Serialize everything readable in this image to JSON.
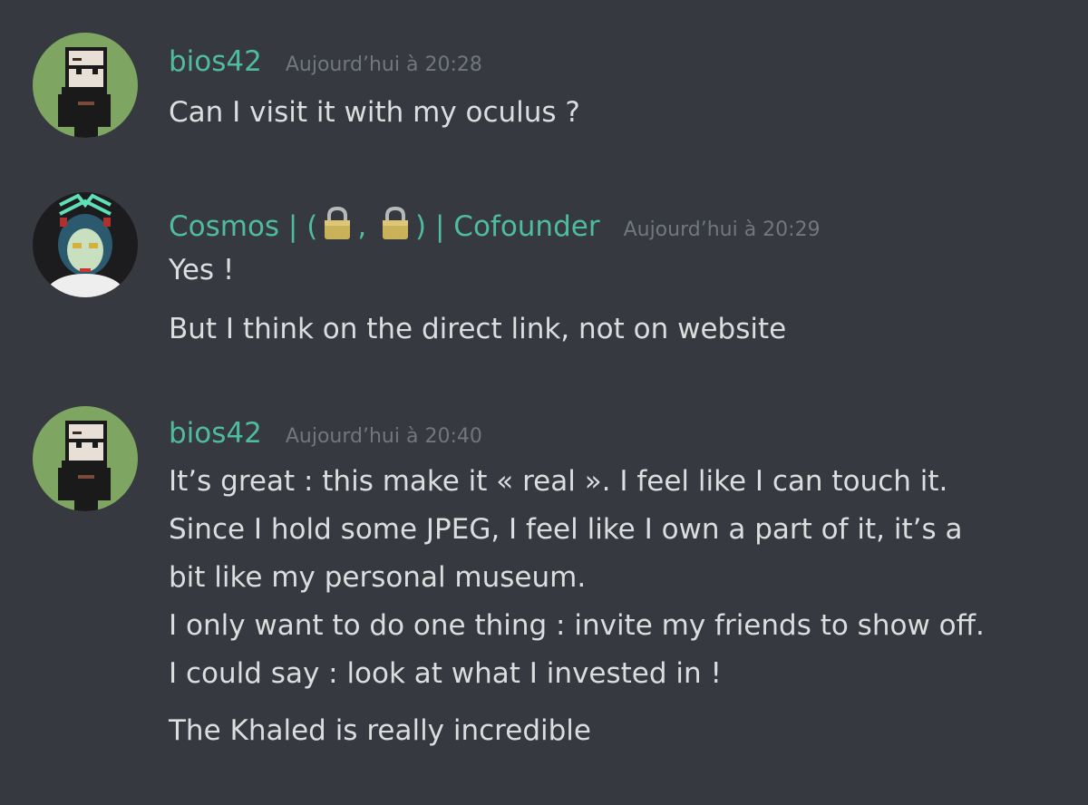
{
  "colors": {
    "background": "#36393f",
    "username": "#4fbd9c",
    "timestamp": "#72767d",
    "text": "#dcddde"
  },
  "messages": [
    {
      "avatar_icon": "bald-bearded-pixel-avatar-icon",
      "username": "bios42",
      "timestamp": "Aujourd’hui à 20:28",
      "lines": [
        "Can I visit it with my oculus ?"
      ]
    },
    {
      "avatar_icon": "anime-girl-avatar-icon",
      "username_parts": [
        "Cosmos | (",
        ",",
        ") | Cofounder"
      ],
      "username_icons": [
        "lock-icon",
        "lock-icon"
      ],
      "timestamp": "Aujourd’hui à 20:29",
      "lines": [
        "Yes !",
        "But I think on the direct link, not on website"
      ]
    },
    {
      "avatar_icon": "bald-bearded-pixel-avatar-icon",
      "username": "bios42",
      "timestamp": "Aujourd’hui à 20:40",
      "lines": [
        "It’s great : this make it « real ». I feel like I can touch it.",
        "Since I hold some JPEG, I feel like I own a part of it, it’s a",
        "bit like my personal museum.",
        "I only want to do one thing : invite my friends to show off.",
        "I could say : look at what I invested in !",
        "The Khaled is really incredible"
      ]
    }
  ]
}
